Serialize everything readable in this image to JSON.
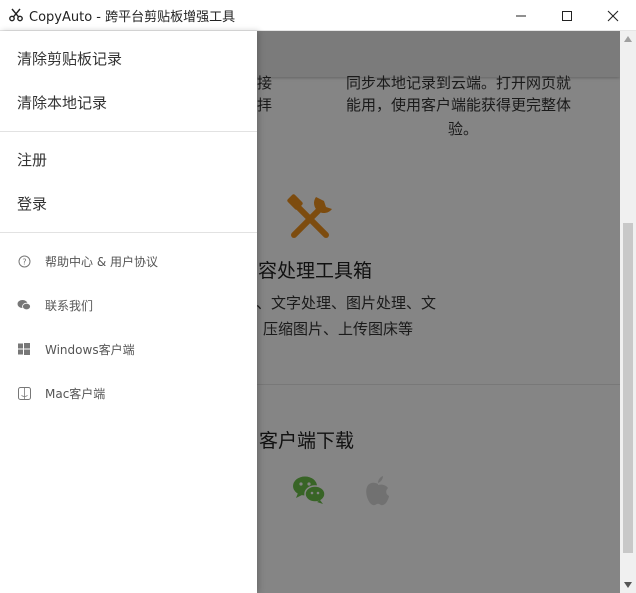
{
  "window": {
    "title": "CopyAuto - 跨平台剪贴板增强工具"
  },
  "content": {
    "sync_line1_partial": "接",
    "sync_line2_partial": "拝",
    "sync_right_line1": "同步本地记录到云端。打开网页就",
    "sync_right_line2": "能用，使用客户端能获得更完整体",
    "sync_right_line3": "验。",
    "tools_title": "容处理工具箱",
    "tools_desc_line1": "、文字处理、图片处理、文",
    "tools_desc_line2": "压缩图片、上传图床等",
    "download_title": "客户端下载",
    "tools_icon": "tools-icon",
    "tools_icon_color": "#f0921e",
    "wechat_icon_color": "#6cc04a"
  },
  "drawer": {
    "clear_clipboard": "清除剪贴板记录",
    "clear_local": "清除本地记录",
    "register": "注册",
    "login": "登录",
    "help": "帮助中心 & 用户协议",
    "contact": "联系我们",
    "windows": "Windows客户端",
    "mac": "Mac客户端"
  }
}
